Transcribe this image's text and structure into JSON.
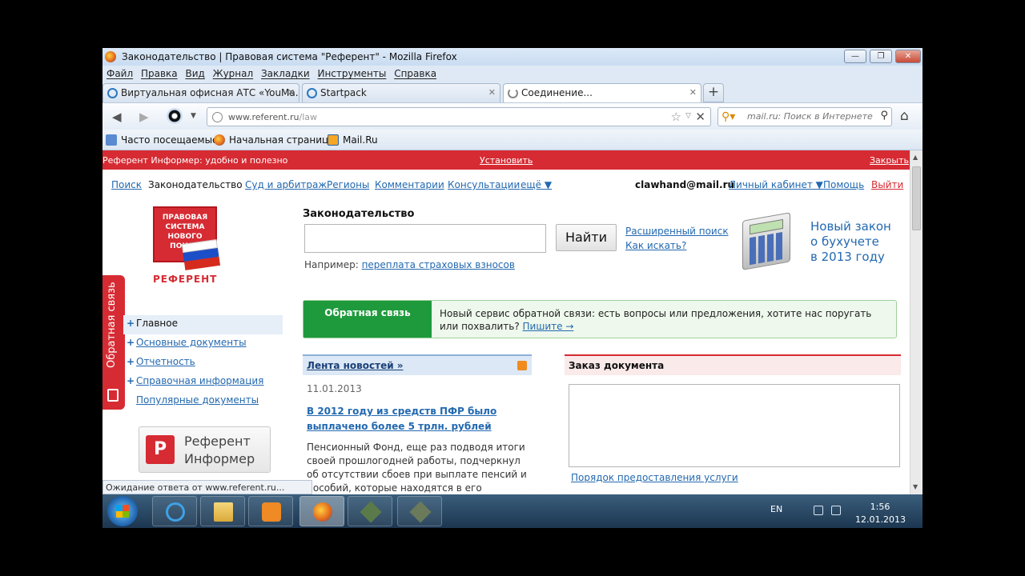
{
  "window": {
    "title": "Законодательство | Правовая система \"Референт\" - Mozilla Firefox",
    "controls": [
      "—",
      "❐",
      "✕"
    ]
  },
  "menu": [
    "Файл",
    "Правка",
    "Вид",
    "Журнал",
    "Закладки",
    "Инструменты",
    "Справка"
  ],
  "tabs": [
    {
      "label": "Виртуальная офисная АТС «YouMa...",
      "close": "✕"
    },
    {
      "label": "Startpack",
      "close": "✕"
    },
    {
      "label": "Соединение...",
      "close": "✕"
    }
  ],
  "newtab": "+",
  "nav": {
    "back": "◀",
    "forward": "▶",
    "url_host": "www.referent.ru",
    "url_path": "/law",
    "search_placeholder": "mail.ru: Поиск в Интернете",
    "home": "⌂"
  },
  "bookmarks": [
    "Часто посещаемые",
    "Начальная страница",
    "Mail.Ru"
  ],
  "infobar": {
    "text": "Референт Информер: удобно и полезно",
    "install": "Установить",
    "close": "Закрыть"
  },
  "topnav": {
    "links": [
      "Поиск",
      "Законодательство",
      "Суд и арбитраж",
      "Регионы",
      "Комментарии",
      "Консультации",
      "ещё ▼"
    ],
    "current": "Законодательство",
    "user": "clawhand@mail.ru",
    "cabinet": "Личный кабинет ▼",
    "help": "Помощь",
    "exit": "Выйти"
  },
  "logo": {
    "line1": "ПРАВОВАЯ",
    "line2": "СИСТЕМА",
    "line3": "НОВОГО",
    "line4": "ПОКОЛ",
    "name": "РЕФЕРЕНТ"
  },
  "feedback_tab": "Обратная связь",
  "sidemenu": [
    {
      "label": "Главное",
      "plus": "+"
    },
    {
      "label": "Основные документы",
      "plus": "+"
    },
    {
      "label": "Отчетность",
      "plus": "+"
    },
    {
      "label": "Справочная информация",
      "plus": "+"
    },
    {
      "label": "Популярные документы",
      "plus": ""
    }
  ],
  "informer": {
    "icon": "Р",
    "line1": "Референт",
    "line2": "Информер"
  },
  "search": {
    "title": "Законодательство",
    "button": "Найти",
    "advanced": "Расширенный поиск",
    "how": "Как искать?",
    "example_label": "Например:",
    "example_link": "переплата страховых взносов"
  },
  "promo": {
    "line1": "Новый закон",
    "line2": "о бухучете",
    "line3": "в 2013 году"
  },
  "feedback_box": {
    "label": "Обратная связь",
    "text": "Новый сервис обратной связи: есть вопросы или предложения, хотите нас поругать или похвалить?",
    "link": "Пишите →"
  },
  "news": {
    "header": "Лента новостей »",
    "date": "11.01.2013",
    "headline": "В 2012 году из средств ПФР было выплачено более 5 трлн. рублей",
    "body": "Пенсионный Фонд, еще раз подводя итоги своей прошлогодней работы, подчеркнул об отсутствии сбоев при выплате пенсий и пособий, которые находятся в его"
  },
  "order": {
    "header": "Заказ документа",
    "link": "Порядок предоставления услуги"
  },
  "status": "Ожидание ответа от www.referent.ru...",
  "scroll": {
    "up": "▲",
    "down": "▼"
  },
  "tray": {
    "lang": "EN",
    "time": "1:56",
    "date": "12.01.2013"
  },
  "colors": {
    "brand_red": "#d62b33",
    "link_blue": "#2369b0",
    "feedback_green": "#1e9a3c"
  }
}
